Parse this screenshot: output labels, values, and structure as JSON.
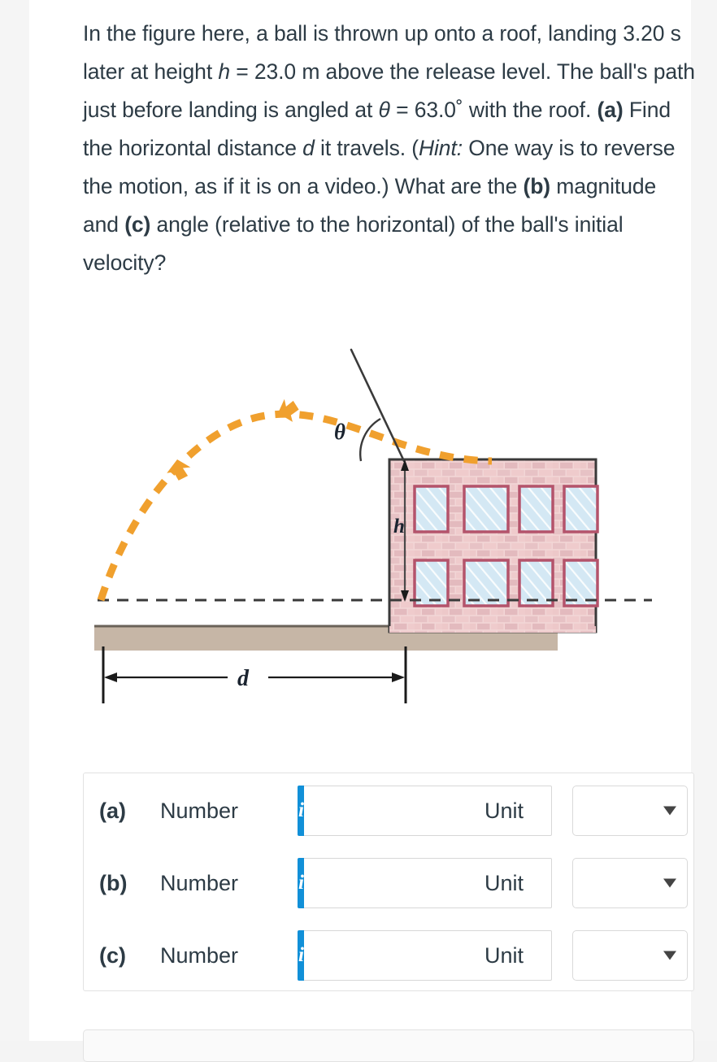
{
  "question": {
    "line1": "In the figure here, a ball is thrown up onto a roof,",
    "line2_pre": "landing 3.20 s later at height ",
    "line2_var": "h",
    "line2_post": " = 23.0 m above the",
    "line3": "release level. The ball's path just before landing is",
    "line4_pre": "angled at ",
    "line4_theta": "θ",
    "line4_mid": " = 63.0˚ with the roof. ",
    "line4_bold": "(a)",
    "line4_post": " Find the",
    "line5_pre": "horizontal distance ",
    "line5_var": "d",
    "line5_mid": " it travels. (",
    "line5_hint": "Hint:",
    "line5_post": " One way is",
    "line6": "to reverse the motion, as if it is on a video.) What",
    "line7_pre": "are the ",
    "line7_b": "(b)",
    "line7_mid": " magnitude and ",
    "line7_c": "(c)",
    "line7_post": " angle (relative to the",
    "line8": "horizontal) of the ball's initial velocity?",
    "values": {
      "time_s": "3.20",
      "height_h_m": "23.0",
      "angle_theta_deg": "63.0"
    }
  },
  "figure": {
    "label_theta": "θ",
    "label_h": "h",
    "label_d": "d",
    "colors": {
      "trajectory": "#F0A02E",
      "brick_fill": "#EDC9C9",
      "brick_line": "#D9A3A8",
      "window_glass": "#D6E9F5",
      "window_frame": "#B4536B",
      "ground": "#C6B6A6",
      "outline": "#3a3a3a"
    },
    "description": "Ball thrown in dashed orange parabolic arc landing on roof of a two-story brick building; theta measured between roof and tangent, h measured down the building face, d measured along the ground."
  },
  "answers": {
    "panel_rows": [
      {
        "tag": "(a)",
        "number_label": "Number",
        "number_value": "",
        "info": "i",
        "unit_label": "Unit",
        "unit_value": ""
      },
      {
        "tag": "(b)",
        "number_label": "Number",
        "number_value": "",
        "info": "i",
        "unit_label": "Unit",
        "unit_value": ""
      },
      {
        "tag": "(c)",
        "number_label": "Number",
        "number_value": "",
        "info": "i",
        "unit_label": "Unit",
        "unit_value": ""
      }
    ],
    "number_placeholder": "",
    "accent_color": "#1190d8"
  }
}
